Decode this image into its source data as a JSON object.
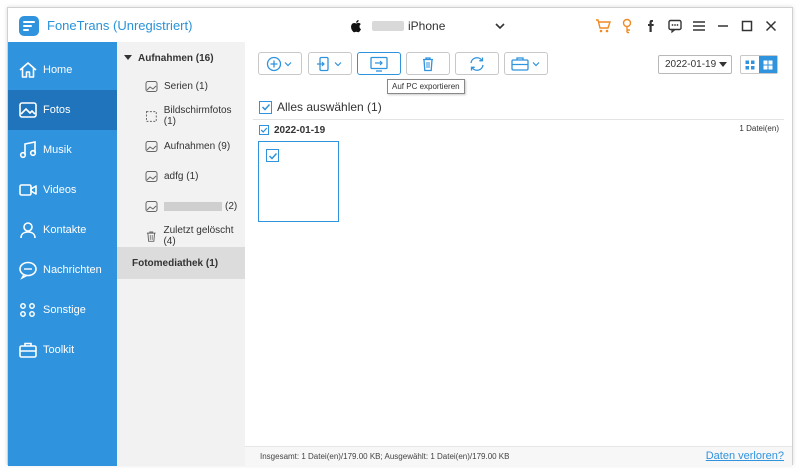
{
  "app": {
    "title": "FoneTrans (Unregistriert)",
    "device_name": "iPhone",
    "accent_color": "#2f93de",
    "titlebar_icons": [
      "cart-icon",
      "key-icon",
      "facebook-icon",
      "chat-icon",
      "menu-icon",
      "minimize-icon",
      "maximize-icon",
      "close-icon"
    ]
  },
  "sidebar": {
    "items": [
      {
        "label": "Home",
        "icon": "home-icon"
      },
      {
        "label": "Fotos",
        "icon": "photos-icon",
        "active": true
      },
      {
        "label": "Musik",
        "icon": "music-icon"
      },
      {
        "label": "Videos",
        "icon": "video-icon"
      },
      {
        "label": "Kontakte",
        "icon": "contacts-icon"
      },
      {
        "label": "Nachrichten",
        "icon": "messages-icon"
      },
      {
        "label": "Sonstige",
        "icon": "other-icon"
      },
      {
        "label": "Toolkit",
        "icon": "toolkit-icon"
      }
    ]
  },
  "albums": {
    "group_label": "Aufnahmen (16)",
    "items": [
      {
        "label": "Serien (1)",
        "icon": "album-icon"
      },
      {
        "label": "Bildschirmfotos (1)",
        "icon": "screenshot-icon"
      },
      {
        "label": "Aufnahmen (9)",
        "icon": "album-icon"
      },
      {
        "label": "adfg (1)",
        "icon": "album-icon"
      },
      {
        "label": "(2)",
        "icon": "album-icon",
        "redacted": true
      },
      {
        "label": "Zuletzt gelöscht (4)",
        "icon": "trash-icon"
      }
    ],
    "library_label": "Fotomediathek (1)"
  },
  "toolbar": {
    "buttons": [
      "add-icon",
      "device-export-icon",
      "pc-export-icon",
      "delete-icon",
      "refresh-icon",
      "toolbox-icon"
    ],
    "tooltip": "Auf PC exportieren",
    "date_filter": "2022-01-19"
  },
  "content": {
    "select_all_label": "Alles auswählen (1)",
    "date_group": "2022-01-19",
    "file_count": "1 Datei(en)"
  },
  "status": {
    "summary": "Insgesamt: 1 Datei(en)/179.00 KB; Ausgewählt: 1 Datei(en)/179.00 KB",
    "lost_link": "Daten verloren?"
  }
}
